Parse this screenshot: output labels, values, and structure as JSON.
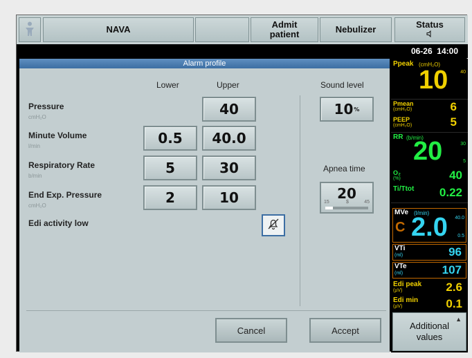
{
  "topbar": {
    "person_icon": "person-icon",
    "nava": "NAVA",
    "admit_line1": "Admit",
    "admit_line2": "patient",
    "nebulizer": "Nebulizer",
    "status": "Status",
    "status_icon": "speaker-icon"
  },
  "datetime": "06-26  14:00",
  "dialog": {
    "title": "Alarm profile",
    "col_lower": "Lower",
    "col_upper": "Upper",
    "sound_level_label": "Sound level",
    "sound_level_value": "10",
    "sound_level_unit": "%",
    "apnea_label": "Apnea time",
    "apnea_value": "20",
    "apnea_min": "15",
    "apnea_mid": "$",
    "apnea_max": "45",
    "apnea_fraction": 0.17,
    "rows": [
      {
        "label": "Pressure",
        "unit": "cmH₂O",
        "lower": "",
        "upper": "40"
      },
      {
        "label": "Minute Volume",
        "unit": "l/min",
        "lower": "0.5",
        "upper": "40.0"
      },
      {
        "label": "Respiratory Rate",
        "unit": "b/min",
        "lower": "5",
        "upper": "30"
      },
      {
        "label": "End Exp. Pressure",
        "unit": "cmH₂O",
        "lower": "2",
        "upper": "10"
      }
    ],
    "edi_label": "Edi activity low",
    "silence_icon": "alarm-off-icon",
    "cancel": "Cancel",
    "accept": "Accept"
  },
  "side": {
    "ppeak_label": "Ppeak",
    "ppeak_unit": "(cmH₂O)",
    "ppeak_value": "10",
    "ppeak_hi": "40",
    "pmean_label": "Pmean",
    "pmean_unit": "(cmH₂O)",
    "pmean_value": "6",
    "peep_label": "PEEP",
    "peep_unit": "(cmH₂O)",
    "peep_value": "5",
    "rr_label": "RR",
    "rr_unit": "(b/min)",
    "rr_value": "20",
    "rr_hi": "30",
    "rr_lo": "5",
    "o2_label": "O₂",
    "o2_unit": "(%)",
    "o2_value": "40",
    "titot_label": "Ti/Ttot",
    "titot_value": "0.22",
    "mve_label": "MVe",
    "mve_unit": "(l/min)",
    "mve_prefix": "C",
    "mve_value": "2.0",
    "mve_hi": "40.0",
    "mve_lo": "0.5",
    "vti_label": "VTi",
    "vti_unit": "(ml)",
    "vti_value": "96",
    "vte_label": "VTe",
    "vte_unit": "(ml)",
    "vte_value": "107",
    "edipeak_label": "Edi peak",
    "edipeak_unit": "(µV)",
    "edipeak_value": "2.6",
    "edimin_label": "Edi min",
    "edimin_unit": "(µV)",
    "edimin_value": "0.1",
    "additional_line1": "Additional",
    "additional_line2": "values"
  },
  "colors": {
    "yellow": "#f0d000",
    "green": "#22ee44",
    "cyan": "#35d4f0",
    "orange": "#c46a00",
    "title_blue": "#3c6ea3"
  }
}
